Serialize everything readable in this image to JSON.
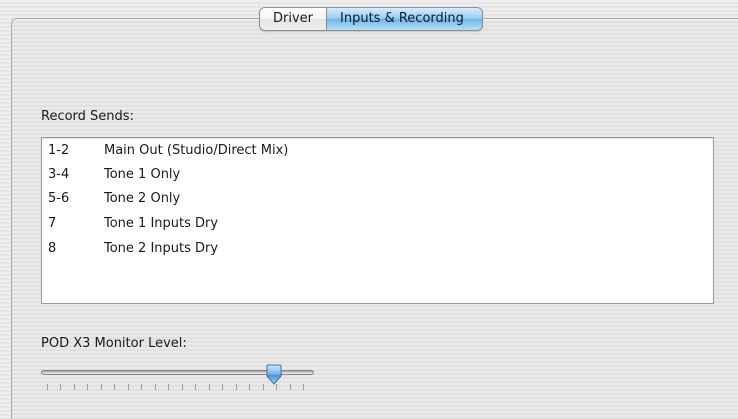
{
  "tabs": [
    {
      "label": "Driver",
      "selected": false
    },
    {
      "label": "Inputs & Recording",
      "selected": true
    }
  ],
  "record_sends": {
    "label": "Record Sends:",
    "rows": [
      {
        "channels": "1-2",
        "description": "Main Out (Studio/Direct Mix)"
      },
      {
        "channels": "3-4",
        "description": "Tone 1 Only"
      },
      {
        "channels": "5-6",
        "description": "Tone 2 Only"
      },
      {
        "channels": "7",
        "description": "Tone 1 Inputs Dry"
      },
      {
        "channels": "8",
        "description": "Tone 2 Inputs Dry"
      }
    ]
  },
  "monitor": {
    "label": "POD X3 Monitor Level:",
    "level": 0.87,
    "tick_count": 20
  },
  "colors": {
    "tab_selected": "#8fc8ef",
    "slider_thumb": "#5f9fe0"
  }
}
